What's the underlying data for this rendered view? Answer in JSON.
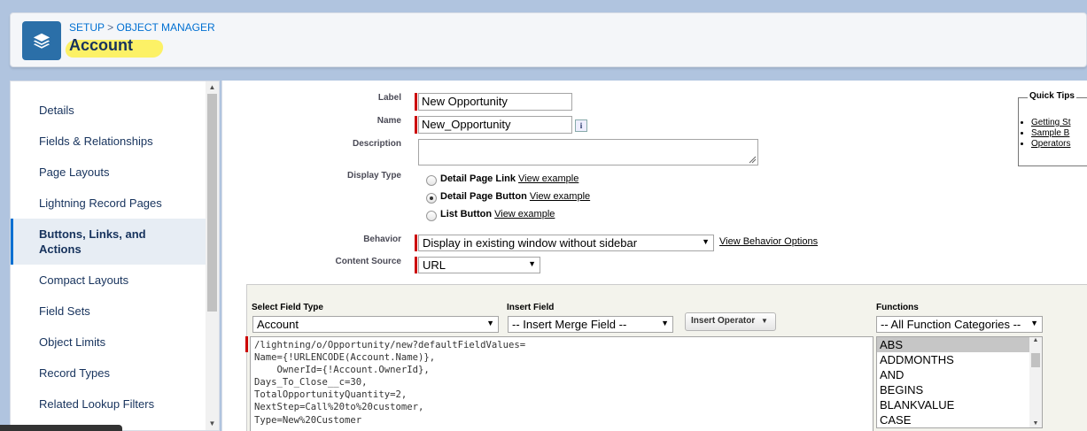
{
  "header": {
    "breadcrumb": [
      "SETUP",
      ">",
      "OBJECT MANAGER"
    ],
    "title": "Account",
    "icon": "layers-icon"
  },
  "sidebar": {
    "items": [
      {
        "label": "Details"
      },
      {
        "label": "Fields & Relationships"
      },
      {
        "label": "Page Layouts"
      },
      {
        "label": "Lightning Record Pages"
      },
      {
        "label": "Buttons, Links, and Actions",
        "active": true
      },
      {
        "label": "Compact Layouts"
      },
      {
        "label": "Field Sets"
      },
      {
        "label": "Object Limits"
      },
      {
        "label": "Record Types"
      },
      {
        "label": "Related Lookup Filters"
      }
    ]
  },
  "form": {
    "label_label": "Label",
    "label_value": "New Opportunity",
    "name_label": "Name",
    "name_value": "New_Opportunity",
    "info_glyph": "i",
    "description_label": "Description",
    "description_value": "",
    "display_type_label": "Display Type",
    "display_options": [
      {
        "label": "Detail Page Link",
        "link": "View example",
        "selected": false
      },
      {
        "label": "Detail Page Button",
        "link": "View example",
        "selected": true
      },
      {
        "label": "List Button",
        "link": "View example",
        "selected": false
      }
    ],
    "behavior_label": "Behavior",
    "behavior_value": "Display in existing window without sidebar",
    "behavior_link": "View Behavior Options",
    "content_source_label": "Content Source",
    "content_source_value": "URL"
  },
  "quick_tips": {
    "title": "Quick Tips",
    "items": [
      "Getting St",
      "Sample B",
      "Operators"
    ]
  },
  "formula": {
    "field_type_label": "Select Field Type",
    "field_type_value": "Account",
    "insert_field_label": "Insert Field",
    "insert_field_value": "-- Insert Merge Field --",
    "insert_operator_label": "Insert Operator",
    "functions_label": "Functions",
    "functions_value": "-- All Function Categories --",
    "code": "/lightning/o/Opportunity/new?defaultFieldValues=\nName={!URLENCODE(Account.Name)},\n    OwnerId={!Account.OwnerId},\nDays_To_Close__c=30,\nTotalOpportunityQuantity=2,\nNextStep=Call%20to%20customer,\nType=New%20Customer",
    "functions": [
      "ABS",
      "ADDMONTHS",
      "AND",
      "BEGINS",
      "BLANKVALUE",
      "CASE"
    ],
    "selected_function": "ABS"
  },
  "colors": {
    "accent": "#0070d2",
    "required": "#c00000",
    "app_icon": "#2b6fa8",
    "highlight": "#fff028"
  }
}
